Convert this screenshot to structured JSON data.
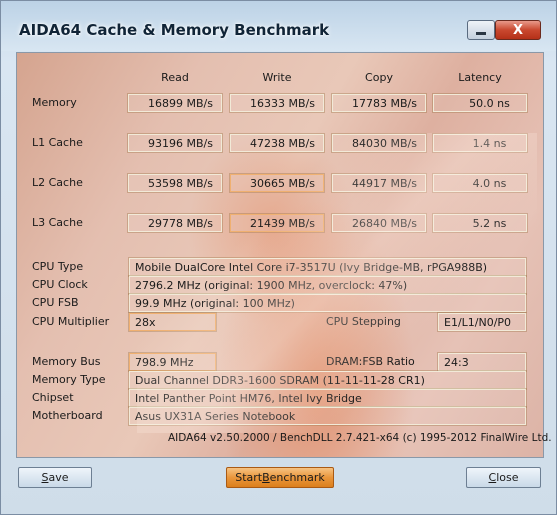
{
  "window": {
    "title": "AIDA64 Cache & Memory Benchmark",
    "minimize_icon": "minimize-icon",
    "close_icon": "close-icon",
    "close_glyph": "X"
  },
  "columns": [
    "Read",
    "Write",
    "Copy",
    "Latency"
  ],
  "rows": [
    {
      "label": "Memory",
      "read": "16899 MB/s",
      "write": "16333 MB/s",
      "copy": "17783 MB/s",
      "latency": "50.0 ns"
    },
    {
      "label": "L1 Cache",
      "read": "93196 MB/s",
      "write": "47238 MB/s",
      "copy": "84030 MB/s",
      "latency": "1.4 ns"
    },
    {
      "label": "L2 Cache",
      "read": "53598 MB/s",
      "write": "30665 MB/s",
      "copy": "44917 MB/s",
      "latency": "4.0 ns"
    },
    {
      "label": "L3 Cache",
      "read": "29778 MB/s",
      "write": "21439 MB/s",
      "copy": "26840 MB/s",
      "latency": "5.2 ns"
    }
  ],
  "cpu": {
    "type_label": "CPU Type",
    "type_value": "Mobile DualCore Intel Core i7-3517U  (Ivy Bridge-MB, rPGA988B)",
    "clock_label": "CPU Clock",
    "clock_value": "2796.2 MHz  (original: 1900 MHz, overclock: 47%)",
    "fsb_label": "CPU FSB",
    "fsb_value": "99.9 MHz  (original: 100 MHz)",
    "multiplier_label": "CPU Multiplier",
    "multiplier_value": "28x",
    "stepping_label": "CPU Stepping",
    "stepping_value": "E1/L1/N0/P0"
  },
  "memory": {
    "bus_label": "Memory Bus",
    "bus_value": "798.9 MHz",
    "ratio_label": "DRAM:FSB Ratio",
    "ratio_value": "24:3",
    "type_label": "Memory Type",
    "type_value": "Dual Channel DDR3-1600 SDRAM  (11-11-11-28 CR1)",
    "chipset_label": "Chipset",
    "chipset_value": "Intel Panther Point HM76, Intel Ivy Bridge",
    "motherboard_label": "Motherboard",
    "motherboard_value": "Asus UX31A Series Notebook"
  },
  "footer": "AIDA64 v2.50.2000 / BenchDLL 2.7.421-x64  (c) 1995-2012 FinalWire Ltd.",
  "buttons": {
    "save_first": "S",
    "save_rest": "ave",
    "start_pre": "Start ",
    "start_mnemonic": "B",
    "start_rest": "enchmark",
    "close_first": "C",
    "close_rest": "lose"
  }
}
